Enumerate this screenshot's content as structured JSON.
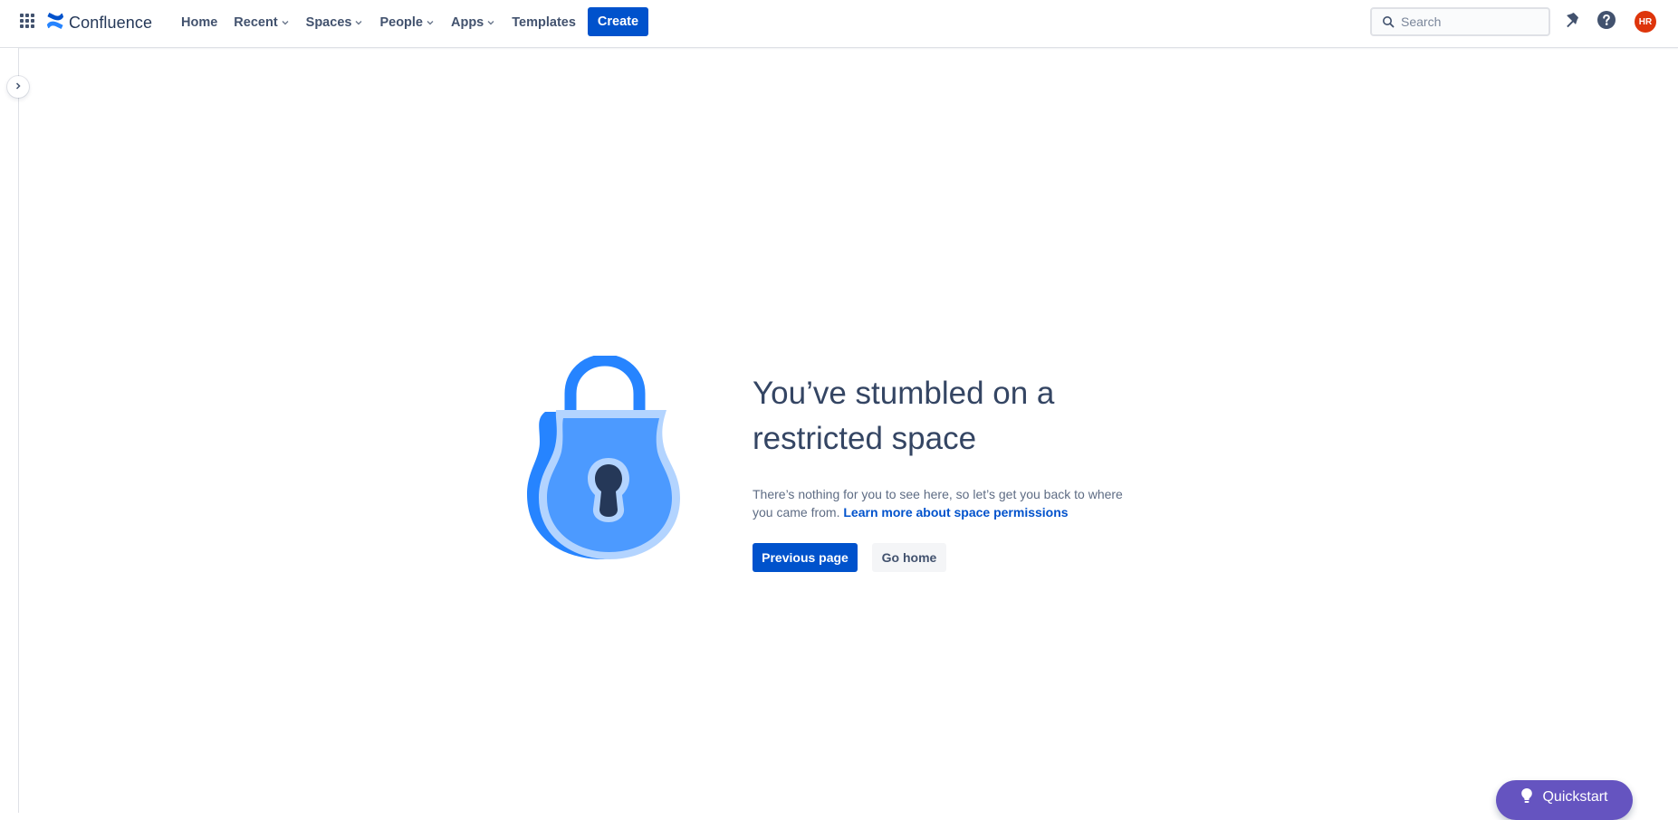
{
  "header": {
    "app_name": "Confluence",
    "nav": [
      {
        "label": "Home",
        "has_dropdown": false
      },
      {
        "label": "Recent",
        "has_dropdown": true
      },
      {
        "label": "Spaces",
        "has_dropdown": true
      },
      {
        "label": "People",
        "has_dropdown": true
      },
      {
        "label": "Apps",
        "has_dropdown": true
      },
      {
        "label": "Templates",
        "has_dropdown": false
      }
    ],
    "create_label": "Create",
    "search_placeholder": "Search",
    "search_value": "",
    "avatar_initials": "HR",
    "icons": [
      "app-switcher-icon",
      "confluence-logo-icon",
      "search-icon",
      "notification-icon",
      "help-icon"
    ]
  },
  "sidebar": {
    "expand_icon": "chevron-right-icon"
  },
  "error": {
    "title": "You’ve stumbled on a restricted space",
    "description": "There’s nothing for you to see here, so let’s get you back to where you came from.",
    "link_label": "Learn more about space permissions",
    "primary_button": "Previous page",
    "secondary_button": "Go home",
    "illustration": "padlock-icon"
  },
  "quickstart": {
    "label": "Quickstart",
    "icon": "lightbulb-icon"
  },
  "colors": {
    "brand_blue": "#0052CC",
    "text_dark": "#172B4D",
    "headline": "#344563",
    "subtle_text": "#5E6C84",
    "quickstart_purple": "#6554C0",
    "avatar_red": "#DE350B",
    "lock_dark_blue": "#2684FF",
    "lock_mid_blue": "#4C9AFF",
    "lock_light_blue": "#B3D4FF",
    "keyhole": "#253858"
  }
}
